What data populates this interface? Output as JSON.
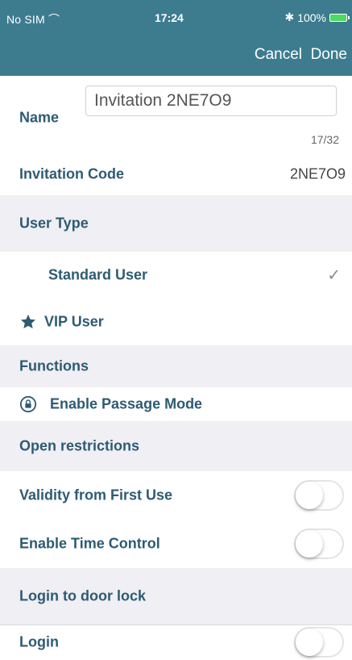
{
  "status_bar": {
    "carrier": "No SIM",
    "time": "17:24",
    "battery_text": "100%"
  },
  "nav": {
    "cancel": "Cancel",
    "done": "Done"
  },
  "name": {
    "label": "Name",
    "value": "Invitation 2NE7O9",
    "counter": "17/32"
  },
  "invitation_code": {
    "label": "Invitation Code",
    "value": "2NE7O9"
  },
  "user_type": {
    "header": "User Type",
    "options": [
      {
        "label": "Standard User",
        "selected": true
      },
      {
        "label": "VIP User",
        "selected": false
      }
    ]
  },
  "functions": {
    "header": "Functions",
    "passage_mode": "Enable Passage Mode"
  },
  "open_restrictions": {
    "header": "Open restrictions",
    "validity_label": "Validity from First Use",
    "time_control_label": "Enable Time Control"
  },
  "login_to_door_lock": {
    "header": "Login to door lock",
    "login_label": "Login"
  },
  "colors": {
    "accent": "#3d7c8f",
    "label": "#2e5b72",
    "section_bg": "#efeff4"
  }
}
